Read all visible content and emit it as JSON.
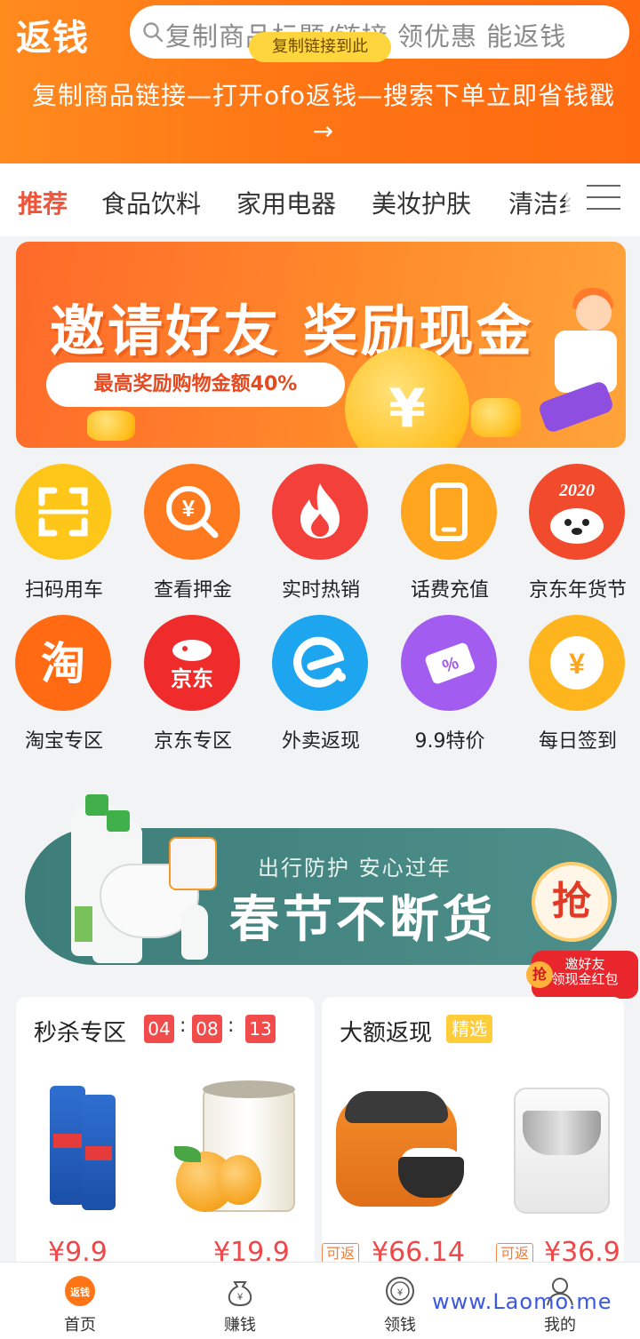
{
  "header": {
    "logo_text": "返钱",
    "search_placeholder": "复制商品标题/链接 领优惠 能返钱",
    "tooltip": "复制链接到此",
    "instruction": "复制商品链接—打开ofo返钱—搜索下单立即省钱戳→"
  },
  "tabs": [
    {
      "label": "推荐",
      "active": true
    },
    {
      "label": "食品饮料",
      "active": false
    },
    {
      "label": "家用电器",
      "active": false
    },
    {
      "label": "美妆护肤",
      "active": false
    },
    {
      "label": "清洁纟",
      "active": false
    }
  ],
  "promo_banner": {
    "title": "邀请好友 奖励现金",
    "subtitle": "最高奖励购物金额40%",
    "coin_symbol": "¥"
  },
  "grid": [
    {
      "label": "扫码用车",
      "icon": "scan-icon",
      "color": "#ffc61a"
    },
    {
      "label": "查看押金",
      "icon": "deposit-search-icon",
      "color": "#ff7a1e"
    },
    {
      "label": "实时热销",
      "icon": "flame-icon",
      "color": "#f3403a"
    },
    {
      "label": "话费充值",
      "icon": "phone-icon",
      "color": "#ffa51e"
    },
    {
      "label": "京东年货节",
      "icon": "jd-festival-icon",
      "color": "#f14a2c",
      "badge_text": "2020"
    },
    {
      "label": "淘宝专区",
      "icon": "taobao-icon",
      "color": "#ff6a12",
      "glyph": "淘"
    },
    {
      "label": "京东专区",
      "icon": "jd-icon",
      "color": "#ef2b2b",
      "glyph": "京东"
    },
    {
      "label": "外卖返现",
      "icon": "eleme-icon",
      "color": "#1ea5f0"
    },
    {
      "label": "9.9特价",
      "icon": "discount-tag-icon",
      "color": "#a35cf0",
      "tag_text": "%"
    },
    {
      "label": "每日签到",
      "icon": "coin-checkin-icon",
      "color": "#ffb51e",
      "glyph": "¥"
    }
  ],
  "spring_banner": {
    "subtitle": "出行防护 安心过年",
    "title": "春节不断货",
    "grab_label": "抢",
    "badge_line1": "邀好友",
    "badge_line2": "领现金红包",
    "badge_grab": "抢"
  },
  "flash_sale": {
    "title": "秒杀专区",
    "timer": [
      "04",
      "08",
      "13"
    ],
    "separator": ":",
    "products": [
      {
        "name": "toothpaste",
        "price": "¥9.9"
      },
      {
        "name": "canned-peach",
        "price": "¥19.9"
      }
    ]
  },
  "cashback": {
    "title": "大额返现",
    "tag": "精选",
    "rebate_label": "可返",
    "products": [
      {
        "name": "rice-cooker",
        "price": "¥66.14"
      },
      {
        "name": "dough-mixer",
        "price": "¥36.9"
      }
    ]
  },
  "bottom_nav": [
    {
      "label": "首页",
      "icon": "home-icon",
      "active": true,
      "glyph": "返钱"
    },
    {
      "label": "赚钱",
      "icon": "money-bag-icon",
      "active": false
    },
    {
      "label": "领钱",
      "icon": "coin-icon",
      "active": false
    },
    {
      "label": "我的",
      "icon": "profile-icon",
      "active": false
    }
  ],
  "watermark": "www.Laomo.me",
  "colors": {
    "brand_orange": "#ff7414",
    "accent_red": "#f0553a",
    "price_red": "#f04848"
  }
}
